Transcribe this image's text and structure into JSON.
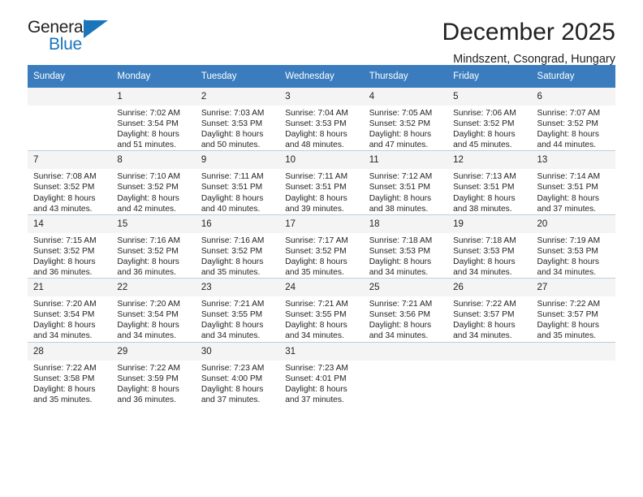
{
  "brand": {
    "name_part1": "General",
    "name_part2": "Blue",
    "triangle_color": "#1b75bb"
  },
  "header": {
    "title": "December 2025",
    "subtitle": "Mindszent, Csongrad, Hungary",
    "header_bg_color": "#3a7cbe"
  },
  "weekday_headers": [
    "Sunday",
    "Monday",
    "Tuesday",
    "Wednesday",
    "Thursday",
    "Friday",
    "Saturday"
  ],
  "labels": {
    "sunrise_prefix": "Sunrise:",
    "sunset_prefix": "Sunset:",
    "daylight_prefix": "Daylight:"
  },
  "weeks": [
    [
      {
        "day": "",
        "empty": true,
        "line1": "",
        "line2": "",
        "line3": "",
        "line4": ""
      },
      {
        "day": "1",
        "line1": "Sunrise: 7:02 AM",
        "line2": "Sunset: 3:54 PM",
        "line3": "Daylight: 8 hours",
        "line4": "and 51 minutes."
      },
      {
        "day": "2",
        "line1": "Sunrise: 7:03 AM",
        "line2": "Sunset: 3:53 PM",
        "line3": "Daylight: 8 hours",
        "line4": "and 50 minutes."
      },
      {
        "day": "3",
        "line1": "Sunrise: 7:04 AM",
        "line2": "Sunset: 3:53 PM",
        "line3": "Daylight: 8 hours",
        "line4": "and 48 minutes."
      },
      {
        "day": "4",
        "line1": "Sunrise: 7:05 AM",
        "line2": "Sunset: 3:52 PM",
        "line3": "Daylight: 8 hours",
        "line4": "and 47 minutes."
      },
      {
        "day": "5",
        "line1": "Sunrise: 7:06 AM",
        "line2": "Sunset: 3:52 PM",
        "line3": "Daylight: 8 hours",
        "line4": "and 45 minutes."
      },
      {
        "day": "6",
        "line1": "Sunrise: 7:07 AM",
        "line2": "Sunset: 3:52 PM",
        "line3": "Daylight: 8 hours",
        "line4": "and 44 minutes."
      }
    ],
    [
      {
        "day": "7",
        "line1": "Sunrise: 7:08 AM",
        "line2": "Sunset: 3:52 PM",
        "line3": "Daylight: 8 hours",
        "line4": "and 43 minutes."
      },
      {
        "day": "8",
        "line1": "Sunrise: 7:10 AM",
        "line2": "Sunset: 3:52 PM",
        "line3": "Daylight: 8 hours",
        "line4": "and 42 minutes."
      },
      {
        "day": "9",
        "line1": "Sunrise: 7:11 AM",
        "line2": "Sunset: 3:51 PM",
        "line3": "Daylight: 8 hours",
        "line4": "and 40 minutes."
      },
      {
        "day": "10",
        "line1": "Sunrise: 7:11 AM",
        "line2": "Sunset: 3:51 PM",
        "line3": "Daylight: 8 hours",
        "line4": "and 39 minutes."
      },
      {
        "day": "11",
        "line1": "Sunrise: 7:12 AM",
        "line2": "Sunset: 3:51 PM",
        "line3": "Daylight: 8 hours",
        "line4": "and 38 minutes."
      },
      {
        "day": "12",
        "line1": "Sunrise: 7:13 AM",
        "line2": "Sunset: 3:51 PM",
        "line3": "Daylight: 8 hours",
        "line4": "and 38 minutes."
      },
      {
        "day": "13",
        "line1": "Sunrise: 7:14 AM",
        "line2": "Sunset: 3:51 PM",
        "line3": "Daylight: 8 hours",
        "line4": "and 37 minutes."
      }
    ],
    [
      {
        "day": "14",
        "line1": "Sunrise: 7:15 AM",
        "line2": "Sunset: 3:52 PM",
        "line3": "Daylight: 8 hours",
        "line4": "and 36 minutes."
      },
      {
        "day": "15",
        "line1": "Sunrise: 7:16 AM",
        "line2": "Sunset: 3:52 PM",
        "line3": "Daylight: 8 hours",
        "line4": "and 36 minutes."
      },
      {
        "day": "16",
        "line1": "Sunrise: 7:16 AM",
        "line2": "Sunset: 3:52 PM",
        "line3": "Daylight: 8 hours",
        "line4": "and 35 minutes."
      },
      {
        "day": "17",
        "line1": "Sunrise: 7:17 AM",
        "line2": "Sunset: 3:52 PM",
        "line3": "Daylight: 8 hours",
        "line4": "and 35 minutes."
      },
      {
        "day": "18",
        "line1": "Sunrise: 7:18 AM",
        "line2": "Sunset: 3:53 PM",
        "line3": "Daylight: 8 hours",
        "line4": "and 34 minutes."
      },
      {
        "day": "19",
        "line1": "Sunrise: 7:18 AM",
        "line2": "Sunset: 3:53 PM",
        "line3": "Daylight: 8 hours",
        "line4": "and 34 minutes."
      },
      {
        "day": "20",
        "line1": "Sunrise: 7:19 AM",
        "line2": "Sunset: 3:53 PM",
        "line3": "Daylight: 8 hours",
        "line4": "and 34 minutes."
      }
    ],
    [
      {
        "day": "21",
        "line1": "Sunrise: 7:20 AM",
        "line2": "Sunset: 3:54 PM",
        "line3": "Daylight: 8 hours",
        "line4": "and 34 minutes."
      },
      {
        "day": "22",
        "line1": "Sunrise: 7:20 AM",
        "line2": "Sunset: 3:54 PM",
        "line3": "Daylight: 8 hours",
        "line4": "and 34 minutes."
      },
      {
        "day": "23",
        "line1": "Sunrise: 7:21 AM",
        "line2": "Sunset: 3:55 PM",
        "line3": "Daylight: 8 hours",
        "line4": "and 34 minutes."
      },
      {
        "day": "24",
        "line1": "Sunrise: 7:21 AM",
        "line2": "Sunset: 3:55 PM",
        "line3": "Daylight: 8 hours",
        "line4": "and 34 minutes."
      },
      {
        "day": "25",
        "line1": "Sunrise: 7:21 AM",
        "line2": "Sunset: 3:56 PM",
        "line3": "Daylight: 8 hours",
        "line4": "and 34 minutes."
      },
      {
        "day": "26",
        "line1": "Sunrise: 7:22 AM",
        "line2": "Sunset: 3:57 PM",
        "line3": "Daylight: 8 hours",
        "line4": "and 34 minutes."
      },
      {
        "day": "27",
        "line1": "Sunrise: 7:22 AM",
        "line2": "Sunset: 3:57 PM",
        "line3": "Daylight: 8 hours",
        "line4": "and 35 minutes."
      }
    ],
    [
      {
        "day": "28",
        "line1": "Sunrise: 7:22 AM",
        "line2": "Sunset: 3:58 PM",
        "line3": "Daylight: 8 hours",
        "line4": "and 35 minutes."
      },
      {
        "day": "29",
        "line1": "Sunrise: 7:22 AM",
        "line2": "Sunset: 3:59 PM",
        "line3": "Daylight: 8 hours",
        "line4": "and 36 minutes."
      },
      {
        "day": "30",
        "line1": "Sunrise: 7:23 AM",
        "line2": "Sunset: 4:00 PM",
        "line3": "Daylight: 8 hours",
        "line4": "and 37 minutes."
      },
      {
        "day": "31",
        "line1": "Sunrise: 7:23 AM",
        "line2": "Sunset: 4:01 PM",
        "line3": "Daylight: 8 hours",
        "line4": "and 37 minutes."
      },
      {
        "day": "",
        "empty": true,
        "line1": "",
        "line2": "",
        "line3": "",
        "line4": ""
      },
      {
        "day": "",
        "empty": true,
        "line1": "",
        "line2": "",
        "line3": "",
        "line4": ""
      },
      {
        "day": "",
        "empty": true,
        "line1": "",
        "line2": "",
        "line3": "",
        "line4": ""
      }
    ]
  ]
}
